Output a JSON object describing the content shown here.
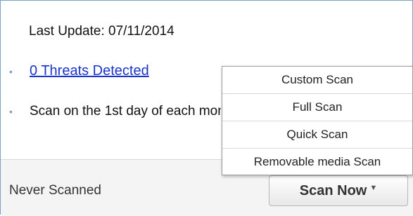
{
  "status": {
    "last_update": "Last Update: 07/11/2014",
    "threats_link": "0 Threats Detected",
    "schedule": "Scan on the 1st day of each month"
  },
  "bullets": [
    "•",
    "•"
  ],
  "footer": {
    "scan_status": "Never Scanned",
    "scan_button_label": "Scan Now",
    "scan_button_caret": "▼"
  },
  "menu": {
    "items": [
      "Custom Scan",
      "Full Scan",
      "Quick Scan",
      "Removable media Scan"
    ]
  },
  "colors": {
    "link": "#1a33cc",
    "border": "#7aa0c8"
  }
}
